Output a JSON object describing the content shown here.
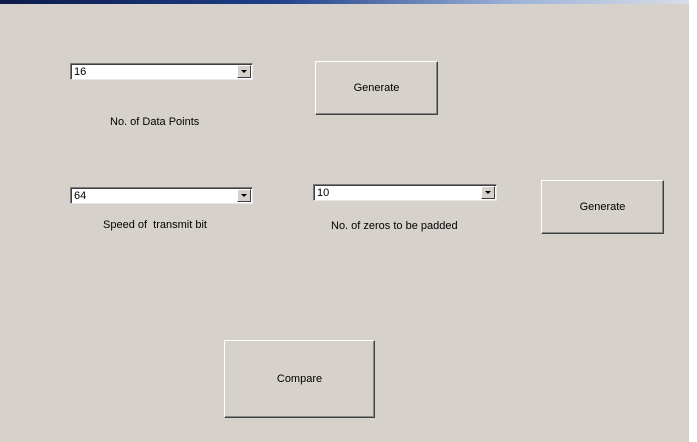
{
  "data_points": {
    "selected": "16",
    "label": "No. of Data Points",
    "generate_label": "Generate"
  },
  "transmit_speed": {
    "selected": "64",
    "label": "Speed of  transmit bit"
  },
  "zero_padding": {
    "selected": "10",
    "label": "No. of zeros to be padded",
    "generate_label": "Generate"
  },
  "compare_label": "Compare",
  "colors": {
    "panel_background": "#d6d2cb"
  }
}
